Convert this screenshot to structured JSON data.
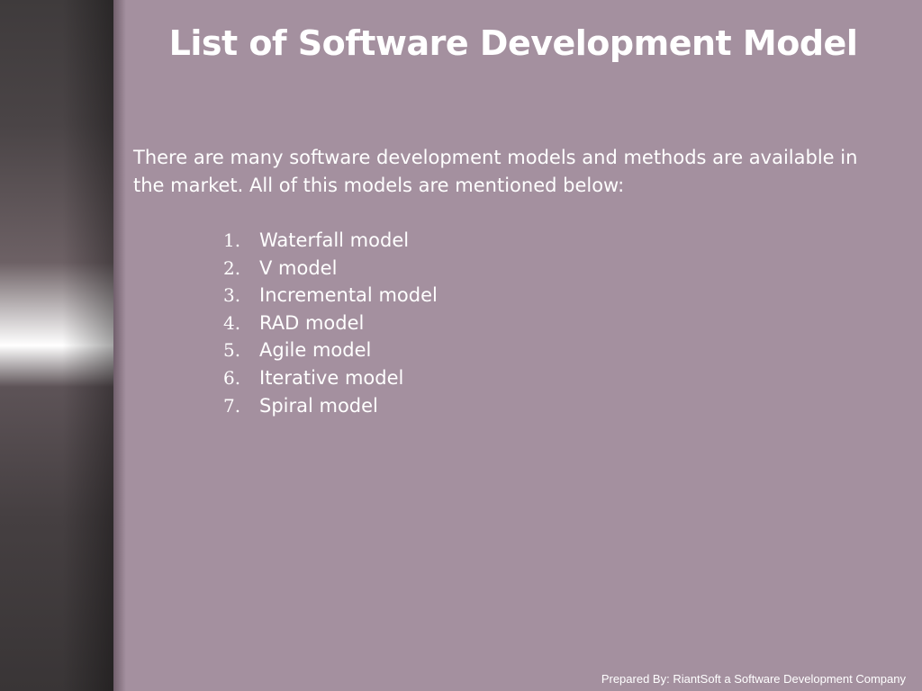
{
  "slide": {
    "title": "List of Software Development Model",
    "intro": "There are many software development models and methods are available in the market. All of this models are mentioned below:",
    "items": [
      {
        "num": "1.",
        "label": "Waterfall model"
      },
      {
        "num": "2.",
        "label": "V model"
      },
      {
        "num": "3.",
        "label": "Incremental model"
      },
      {
        "num": "4.",
        "label": "RAD model"
      },
      {
        "num": "5.",
        "label": "Agile model"
      },
      {
        "num": "6.",
        "label": "Iterative model"
      },
      {
        "num": "7.",
        "label": "Spiral model"
      }
    ],
    "footer": "Prepared By: RiantSoft a Software Development Company"
  },
  "colors": {
    "background": "#a4909f",
    "text": "#ffffff",
    "sidebar": "#453f41"
  }
}
